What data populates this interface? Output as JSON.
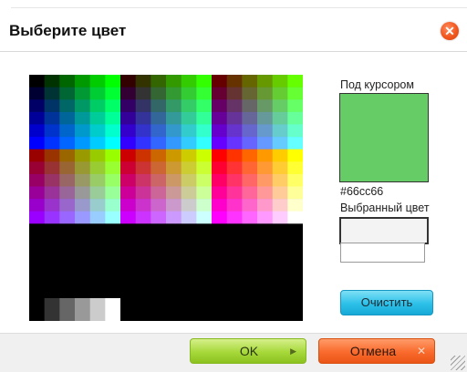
{
  "dialog": {
    "title": "Выберите цвет",
    "close_icon": "close-icon"
  },
  "palette": {
    "web_safe_levels": [
      "00",
      "33",
      "66",
      "99",
      "cc",
      "ff"
    ],
    "grayscale": [
      "#000000",
      "#333333",
      "#666666",
      "#999999",
      "#cccccc",
      "#ffffff"
    ]
  },
  "preview": {
    "hover_label": "Под курсором",
    "hover_color": "#66cc66",
    "hover_hex": "#66cc66",
    "selected_label": "Выбранный цвет",
    "selected_color": "#f3f3f3",
    "selected_value": ""
  },
  "buttons": {
    "clear": "Очистить",
    "ok": "OK",
    "ok_arrow_icon": "chevron-right-icon",
    "cancel": "Отмена",
    "cancel_icon": "close-icon"
  },
  "colors": {
    "ok_green": "#a6d83a",
    "cancel_orange": "#f96a2c",
    "clear_blue": "#2cc0e8",
    "close_orange": "#f2561e"
  }
}
